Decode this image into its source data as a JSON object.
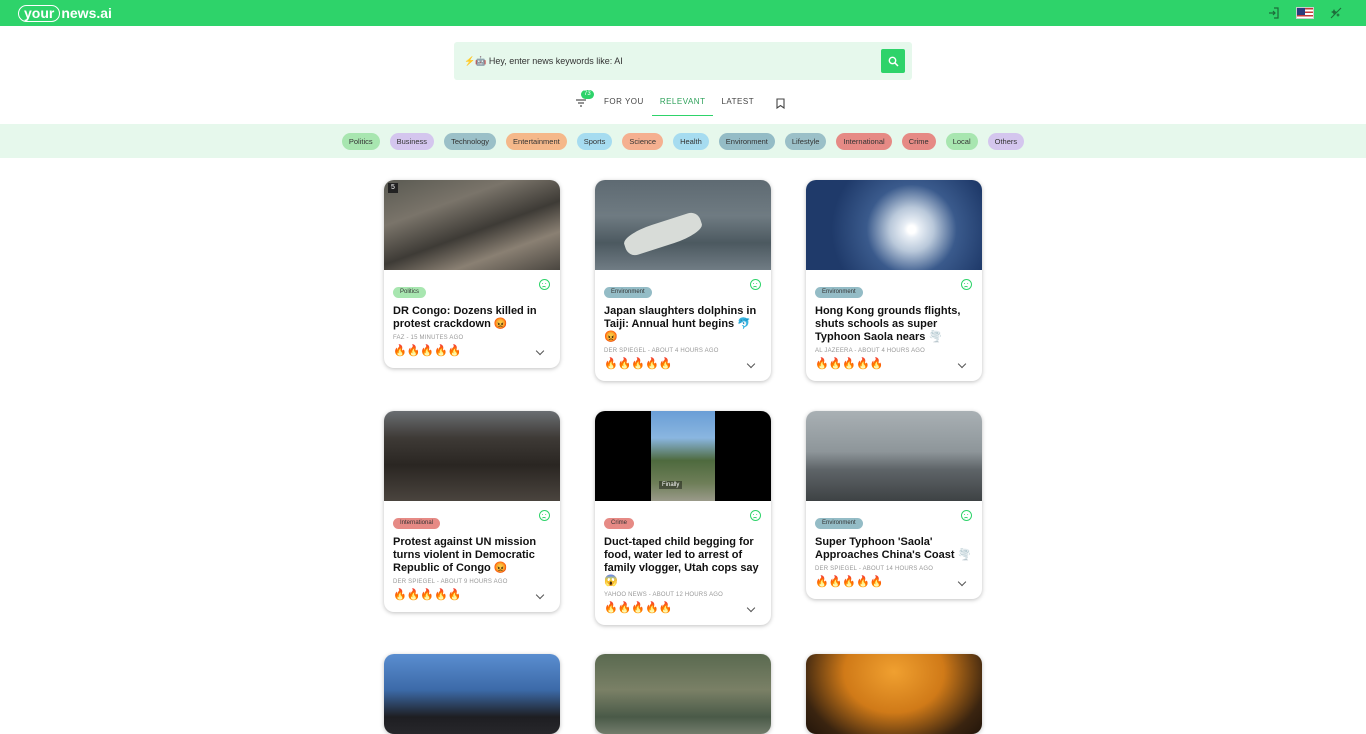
{
  "header": {
    "logo_pill": "your",
    "logo_rest": "news.ai"
  },
  "search": {
    "prompt": "⚡🤖 Hey, enter news keywords like: AI"
  },
  "tabs": {
    "filter_count": "73",
    "items": [
      "FOR YOU",
      "RELEVANT",
      "LATEST"
    ],
    "active": "RELEVANT"
  },
  "categories": [
    {
      "label": "Politics",
      "color": "#a8e6b0"
    },
    {
      "label": "Business",
      "color": "#d4c6ee"
    },
    {
      "label": "Technology",
      "color": "#9bc0c8"
    },
    {
      "label": "Entertainment",
      "color": "#f5b88a"
    },
    {
      "label": "Sports",
      "color": "#a6dcf0"
    },
    {
      "label": "Science",
      "color": "#f5b090"
    },
    {
      "label": "Health",
      "color": "#a6dcf0"
    },
    {
      "label": "Environment",
      "color": "#94bcc6"
    },
    {
      "label": "Lifestyle",
      "color": "#9bc0c8"
    },
    {
      "label": "International",
      "color": "#e68a85"
    },
    {
      "label": "Crime",
      "color": "#e68a85"
    },
    {
      "label": "Local",
      "color": "#a8e6b0"
    },
    {
      "label": "Others",
      "color": "#d4c6ee"
    }
  ],
  "cards": [
    {
      "tag": "Politics",
      "tag_color": "#a8e6b0",
      "title": "DR Congo: Dozens killed in protest crackdown 😡",
      "meta": "FAZ - 15 MINUTES AGO",
      "fires": "🔥🔥🔥🔥🔥",
      "play_label": "5"
    },
    {
      "tag": "Environment",
      "tag_color": "#94bcc6",
      "title": "Japan slaughters dolphins in Taiji: Annual hunt begins 🐬😡",
      "meta": "DER SPIEGEL - ABOUT 4 HOURS AGO",
      "fires": "🔥🔥🔥🔥🔥"
    },
    {
      "tag": "Environment",
      "tag_color": "#94bcc6",
      "title": "Hong Kong grounds flights, shuts schools as super Typhoon Saola nears 🌪️",
      "meta": "AL JAZEERA - ABOUT 4 HOURS AGO",
      "fires": "🔥🔥🔥🔥🔥"
    },
    {
      "tag": "International",
      "tag_color": "#e68a85",
      "title": "Protest against UN mission turns violent in Democratic Republic of Congo 😡",
      "meta": "DER SPIEGEL - ABOUT 9 HOURS AGO",
      "fires": "🔥🔥🔥🔥🔥"
    },
    {
      "tag": "Crime",
      "tag_color": "#e68a85",
      "title": "Duct-taped child begging for food, water led to arrest of family vlogger, Utah cops say 😱",
      "meta": "YAHOO NEWS - ABOUT 12 HOURS AGO",
      "fires": "🔥🔥🔥🔥🔥",
      "overlay": "Finally"
    },
    {
      "tag": "Environment",
      "tag_color": "#94bcc6",
      "title": "Super Typhoon 'Saola' Approaches China's Coast 🌪️",
      "meta": "DER SPIEGEL - ABOUT 14 HOURS AGO",
      "fires": "🔥🔥🔥🔥🔥"
    }
  ]
}
